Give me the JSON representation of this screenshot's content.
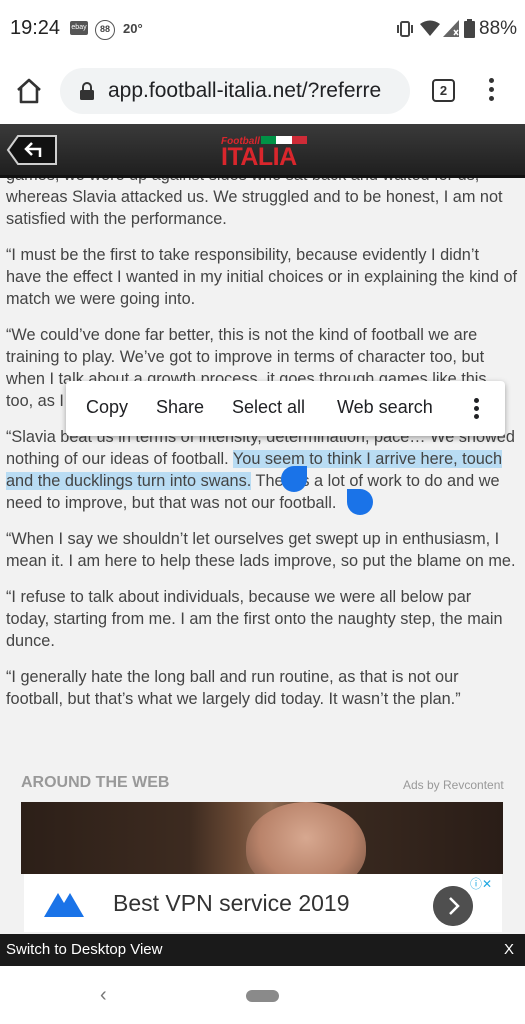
{
  "status_bar": {
    "time": "19:24",
    "ebay_label": "ebay",
    "badge": "88",
    "temperature": "20°",
    "battery": "88%",
    "icons": [
      "ebay-icon",
      "vibrate-icon",
      "wifi-icon",
      "signal-icon",
      "battery-icon"
    ]
  },
  "browser": {
    "url": "app.football-italia.net/?referre",
    "tab_count": "2"
  },
  "site": {
    "logo_small": "Football",
    "logo_main": "ITALIA",
    "flag_colors": [
      "#009246",
      "#ffffff",
      "#ce2b37"
    ]
  },
  "article": {
    "paragraphs": [
      {
        "text": "games, we were up against sides who sat back and waited for us, whereas Slavia attacked us. We struggled and to be honest, I am not satisfied with the performance."
      },
      {
        "text": "“I must be the first to take responsibility, because evidently I didn’t have the effect I wanted in my initial choices or in explaining the kind of match we were going into."
      },
      {
        "text": "“We could’ve done far better, this is not the kind of football we are training to play. We’ve got to improve in terms of character too, but when I talk about a growth process, it goes through games like this too, as I said before."
      },
      {
        "before": "“Slavia beat us in terms of intensity, determination, pace… We showed nothing of our ideas of football. ",
        "highlight": "You seem to think I arrive here, touch and the ducklings turn into swans.",
        "after": " There’s a lot of work to do and we need to improve, but that was not our football."
      },
      {
        "text": "“When I say we shouldn’t let ourselves get swept up in enthusiasm, I mean it. I am here to help these lads improve, so put the blame on me."
      },
      {
        "text": "“I refuse to talk about individuals, because we were all below par today, starting from me. I am the first onto the naughty step, the main dunce."
      },
      {
        "text": "“I generally hate the long ball and run routine, as that is not our football, but that’s what we largely did today. It wasn’t the plan.”"
      }
    ],
    "selection_color": "#b9dcf3",
    "handle_color": "#1a73e8"
  },
  "context_menu": {
    "copy": "Copy",
    "share": "Share",
    "select_all": "Select all",
    "web_search": "Web search"
  },
  "around": {
    "title": "AROUND THE WEB",
    "ads_by": "Ads by Revcontent"
  },
  "vpn_ad": {
    "title": "Best VPN service 2019",
    "adchoice": "ⓘ✕",
    "logo_color": "#1a73e8"
  },
  "desktop_bar": {
    "label": "Switch to Desktop View",
    "close": "X"
  },
  "nav": {
    "back": "‹"
  }
}
